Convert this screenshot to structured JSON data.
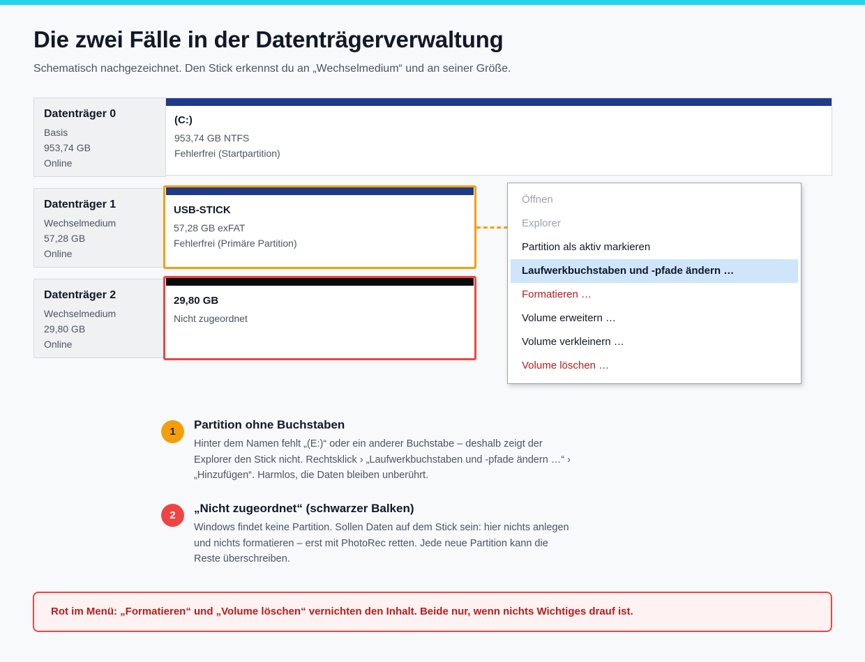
{
  "header": {
    "title": "Die zwei Fälle in der Datenträgerverwaltung",
    "subtitle": "Schematisch nachgezeichnet. Den Stick erkennst du an „Wechselmedium“ und an seiner Größe."
  },
  "disks": [
    {
      "name": "Datenträger 0",
      "type": "Basis",
      "size": "953,74 GB",
      "status": "Online",
      "partition": {
        "title": "(C:)",
        "line1": "953,74 GB NTFS",
        "line2": "Fehlerfrei (Startpartition)"
      }
    },
    {
      "name": "Datenträger 1",
      "type": "Wechselmedium",
      "size": "57,28 GB",
      "status": "Online",
      "partition": {
        "title": "USB-STICK",
        "line1": "57,28 GB exFAT",
        "line2": "Fehlerfrei (Primäre Partition)"
      }
    },
    {
      "name": "Datenträger 2",
      "type": "Wechselmedium",
      "size": "29,80 GB",
      "status": "Online",
      "partition": {
        "title": "29,80 GB",
        "line1": "Nicht zugeordnet"
      }
    }
  ],
  "context_menu": {
    "items": [
      "Öffnen",
      "Explorer",
      "Partition als aktiv markieren",
      "Laufwerkbuchstaben und -pfade ändern …",
      "Formatieren …",
      "Volume erweitern …",
      "Volume verkleinern …",
      "Volume löschen …"
    ]
  },
  "callouts": [
    {
      "number": "1",
      "title": "Partition ohne Buchstaben",
      "text": "Hinter dem Namen fehlt „(E:)“ oder ein anderer Buchstabe – deshalb zeigt der Explorer den Stick nicht. Rechtsklick › „Laufwerkbuchstaben und -pfade ändern …“ › „Hinzufügen“. Harmlos, die Daten bleiben unberührt."
    },
    {
      "number": "2",
      "title": "„Nicht zugeordnet“ (schwarzer Balken)",
      "text": "Windows findet keine Partition. Sollen Daten auf dem Stick sein: hier nichts anlegen und nichts formatieren – erst mit PhotoRec retten. Jede neue Partition kann die Reste überschreiben."
    }
  ],
  "warning": "Rot im Menü: „Formatieren“ und „Volume löschen“ vernichten den Inhalt. Beide nur, wenn nichts Wichtiges drauf ist.",
  "colors": {
    "accent_top": "#22d3ee",
    "partition_stripe": "#1e3a8a",
    "unallocated_stripe": "#0b0b0b",
    "highlight_orange": "#f59e0b",
    "highlight_red": "#ef4444",
    "menu_selected": "#cfe5fb",
    "danger_text": "#b91c1c"
  }
}
